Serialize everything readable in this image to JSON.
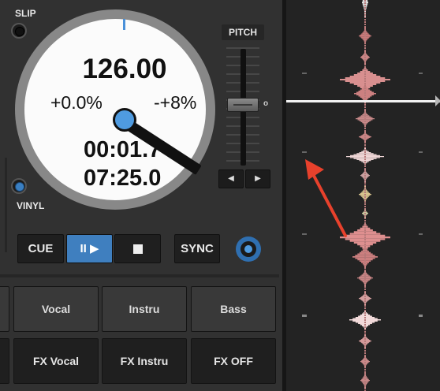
{
  "deck": {
    "slip_label": "SLIP",
    "vinyl_label": "VINYL",
    "pitch_label": "PITCH",
    "pitch_zero": "o",
    "nudge_left": "◀",
    "nudge_right": "▶",
    "bpm": "126.00",
    "pitch_percent": "+0.0%",
    "pitch_range": "-+8%",
    "elapsed_time": "00:01.7",
    "remaining_time": "07:25.0"
  },
  "transport": {
    "cue_label": "CUE",
    "play_pause_label": "II ▶",
    "sync_label": "SYNC"
  },
  "pads": {
    "top": [
      "Vocal",
      "Instru",
      "Bass"
    ],
    "bottom": [
      "FX Vocal",
      "FX Instru",
      "FX OFF"
    ]
  },
  "colors": {
    "accent": "#4a90d9",
    "play_active": "#3f7fbf",
    "annotation_arrow": "#e8412c",
    "waveform": "#d98c8c"
  },
  "icons": {
    "slip": "led-indicator-icon",
    "vinyl": "led-indicator-icon",
    "stop": "stop-square-icon",
    "options": "target-icon",
    "playhead": "playhead-marker-icon"
  }
}
